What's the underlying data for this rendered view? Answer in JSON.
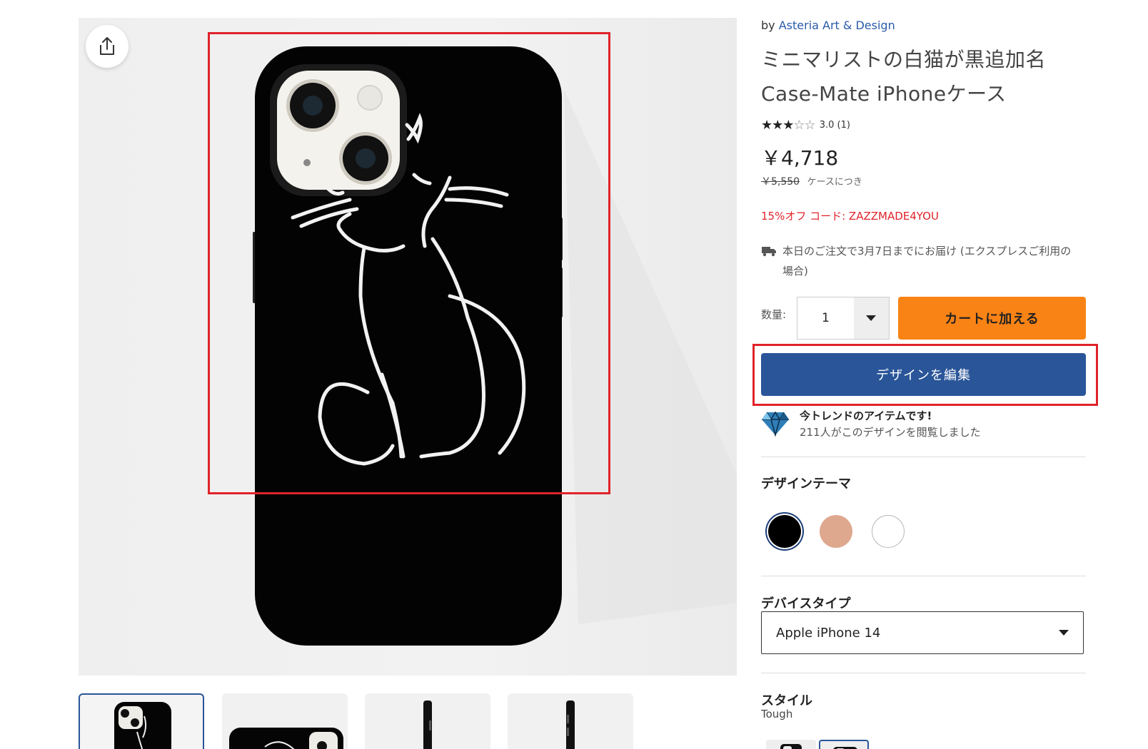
{
  "product": {
    "by_prefix": "by",
    "designer": "Asteria Art & Design",
    "title_line1": "ミニマリストの白猫が黒追加名",
    "title_line2": "Case-Mate iPhoneケース",
    "stars_filled": "★★★",
    "stars_empty": "☆☆",
    "rating_text": "3.0 (1)",
    "rating_value": 3.0,
    "price": "￥4,718",
    "old_price": "￥5,550",
    "per_unit": "ケースにつき",
    "promo": "15%オフ コード: ZAZZMADE4YOU",
    "delivery": "本日のご注文で3月7日までにお届け (エクスプレスご利用の場合)"
  },
  "purchase": {
    "qty_label": "数量:",
    "qty_value": "1",
    "add_to_cart": "カートに加える",
    "edit_design": "デザインを編集"
  },
  "trend": {
    "title": "今トレンドのアイテムです!",
    "subtitle": "211人がこのデザインを閲覧しました"
  },
  "options": {
    "theme_label": "デザインテーマ",
    "themes": [
      {
        "name": "black",
        "color": "#000000",
        "selected": true
      },
      {
        "name": "peach",
        "color": "#dea88f",
        "selected": false
      },
      {
        "name": "white",
        "color": "#ffffff",
        "selected": false
      }
    ],
    "device_label": "デバイスタイプ",
    "device_value": "Apple iPhone 14",
    "style_label": "スタイル",
    "style_value": "Tough"
  },
  "colors": {
    "accent_blue": "#2a5599",
    "cart_orange": "#fa8315",
    "promo_red": "#e0232a",
    "link_blue": "#2a5ba8"
  },
  "icons": {
    "share": "share-icon",
    "truck": "truck-icon",
    "diamond": "diamond-icon",
    "caret": "caret-down-icon"
  }
}
